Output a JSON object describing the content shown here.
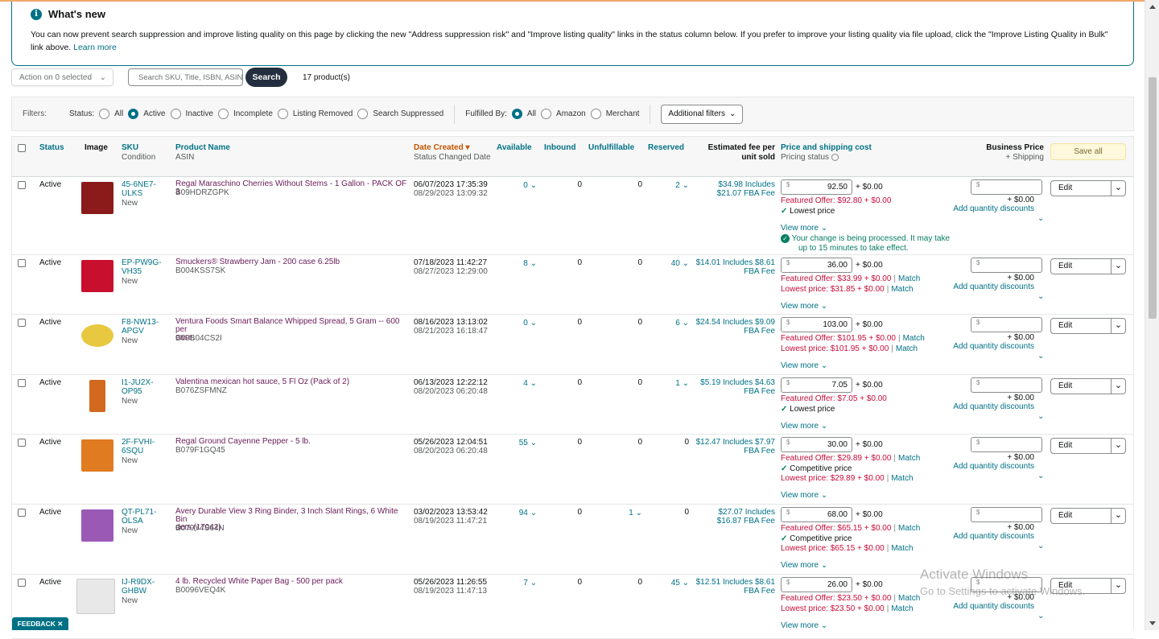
{
  "notice": {
    "title": "What's new",
    "body": "You can now prevent search suppression and improve listing quality on this page by clicking the new \"Address suppression risk\" and \"Improve listing quality\" links in the status column below. If you prefer to improve your listing quality via file upload, click the \"Improve Listing Quality in Bulk\" link above.",
    "learn_more": "Learn more"
  },
  "toolbar": {
    "action_label": "Action on 0 selected",
    "search_placeholder": "Search SKU, Title, ISBN, ASIN",
    "search_button": "Search",
    "product_count": "17 product(s)"
  },
  "filters": {
    "label": "Filters:",
    "status_label": "Status:",
    "status_options": [
      "All",
      "Active",
      "Inactive",
      "Incomplete",
      "Listing Removed",
      "Search Suppressed"
    ],
    "status_selected": "Active",
    "fulfilled_label": "Fulfilled By:",
    "fulfilled_options": [
      "All",
      "Amazon",
      "Merchant"
    ],
    "fulfilled_selected": "All",
    "additional": "Additional filters"
  },
  "columns": {
    "status": "Status",
    "image": "Image",
    "sku": "SKU",
    "condition": "Condition",
    "product_name": "Product Name",
    "asin": "ASIN",
    "date_created": "Date Created",
    "status_changed": "Status Changed Date",
    "available": "Available",
    "inbound": "Inbound",
    "unfulfillable": "Unfulfillable",
    "reserved": "Reserved",
    "fee_line1": "Estimated fee per",
    "fee_line2": "unit sold",
    "price": "Price and shipping cost",
    "pricing_status": "Pricing status",
    "business_price": "Business Price",
    "business_shipping": "+ Shipping",
    "save_all": "Save all"
  },
  "rows": [
    {
      "status": "Active",
      "sku1": "45-6NE7-",
      "sku2": "ULKS",
      "condition": "New",
      "name": "Regal Maraschino Cherries Without Stems - 1 Gallon - PACK OF 3",
      "asin": "B09HDRZGPK",
      "created": "06/07/2023 17:35:39",
      "changed": "08/29/2023 13:09:32",
      "available": "0",
      "inbound": "0",
      "unfulfillable": "0",
      "reserved": "2",
      "fee1": "$34.98 Includes",
      "fee2": "$21.07 FBA Fee",
      "price": "92.50",
      "ship": "+ $0.00",
      "featured": "Featured Offer: $92.80 + $0.00",
      "badge": "Lowest price",
      "lowest": "",
      "processing1": "Your change is being processed. It may take",
      "processing2": "up to 15 minutes to take effect.",
      "view_more": "View more",
      "bship": "+ $0.00",
      "qty": "Add quantity discounts",
      "edit": "Edit",
      "img": "#8B1A1A"
    },
    {
      "status": "Active",
      "sku1": "EP-PW9G-",
      "sku2": "VH35",
      "condition": "New",
      "name": "Smuckers® Strawberry Jam - 200 case 6.25lb",
      "asin": "B004KSS7SK",
      "created": "07/18/2023 11:42:27",
      "changed": "08/27/2023 12:29:00",
      "available": "8",
      "inbound": "0",
      "unfulfillable": "0",
      "reserved": "40",
      "fee1": "$14.01 Includes $8.61",
      "fee2": "FBA Fee",
      "price": "36.00",
      "ship": "+ $0.00",
      "featured": "Featured Offer: $33.99 + $0.00",
      "badge": "",
      "lowest": "Lowest price: $31.85 + $0.00",
      "match": "Match",
      "view_more": "View more",
      "bship": "+ $0.00",
      "qty": "Add quantity discounts",
      "edit": "Edit",
      "img": "#C8102E"
    },
    {
      "status": "Active",
      "sku1": "F8-NW13-",
      "sku2": "APGV",
      "condition": "New",
      "name": "Ventura Foods Smart Balance Whipped Spread, 5 Gram -- 600 per",
      "name2": "case.",
      "asin": "B00B04CS2I",
      "created": "08/16/2023 13:13:02",
      "changed": "08/21/2023 16:18:47",
      "available": "0",
      "inbound": "0",
      "unfulfillable": "0",
      "reserved": "6",
      "fee1": "$24.54 Includes $9.09",
      "fee2": "FBA Fee",
      "price": "103.00",
      "ship": "+ $0.00",
      "featured": "Featured Offer: $101.95 + $0.00",
      "badge": "",
      "lowest": "Lowest price: $101.95 + $0.00",
      "match": "Match",
      "view_more": "View more",
      "bship": "+ $0.00",
      "qty": "Add quantity discounts",
      "edit": "Edit",
      "img": "#E8C840"
    },
    {
      "status": "Active",
      "sku1": "I1-JU2X-",
      "sku2": "OP95",
      "condition": "New",
      "name": "Valentina mexican hot sauce, 5 Fl Oz (Pack of 2)",
      "asin": "B076ZSFMNZ",
      "created": "06/13/2023 12:22:12",
      "changed": "08/20/2023 06:20:48",
      "available": "4",
      "inbound": "0",
      "unfulfillable": "0",
      "reserved": "1",
      "fee1": "$5.19 Includes $4.63",
      "fee2": "FBA Fee",
      "price": "7.05",
      "ship": "+ $0.00",
      "featured": "Featured Offer: $7.05 + $0.00",
      "badge": "Lowest price",
      "lowest": "",
      "view_more": "View more",
      "bship": "+ $0.00",
      "qty": "Add quantity discounts",
      "edit": "Edit",
      "img": "#D2691E"
    },
    {
      "status": "Active",
      "sku1": "2F-FVHI-",
      "sku2": "6SQU",
      "condition": "New",
      "name": "Regal Ground Cayenne Pepper - 5 lb.",
      "asin": "B079F1GQ45",
      "created": "05/26/2023 12:04:51",
      "changed": "08/20/2023 06:20:48",
      "available": "55",
      "inbound": "0",
      "unfulfillable": "0",
      "reserved": "0",
      "fee1": "$12.47 Includes $7.97",
      "fee2": "FBA Fee",
      "price": "30.00",
      "ship": "+ $0.00",
      "featured": "Featured Offer: $29.89 + $0.00",
      "badge": "Competitive price",
      "lowest": "Lowest price: $29.89 + $0.00",
      "match": "Match",
      "view_more": "View more",
      "bship": "+ $0.00",
      "qty": "Add quantity discounts",
      "edit": "Edit",
      "img": "#E07B22"
    },
    {
      "status": "Active",
      "sku1": "QT-PL71-",
      "sku2": "OLSA",
      "condition": "New",
      "name": "Avery Durable View 3 Ring Binder, 3 Inch Slant Rings, 6 White Bin",
      "name2": "ders (17042)",
      "asin": "B079Y4S64N",
      "created": "03/02/2023 13:53:42",
      "changed": "08/19/2023 11:47:21",
      "available": "94",
      "inbound": "0",
      "unfulfillable": "1",
      "reserved": "0",
      "fee1": "$27.07 Includes",
      "fee2": "$16.87 FBA Fee",
      "price": "68.00",
      "ship": "+ $0.00",
      "featured": "Featured Offer: $65.15 + $0.00",
      "badge": "Competitive price",
      "lowest": "Lowest price: $65.15 + $0.00",
      "match": "Match",
      "view_more": "View more",
      "bship": "+ $0.00",
      "qty": "Add quantity discounts",
      "edit": "Edit",
      "img": "#9B59B6"
    },
    {
      "status": "Active",
      "sku1": "IJ-R9DX-",
      "sku2": "GHBW",
      "condition": "New",
      "name": "4 lb. Recycled White Paper Bag - 500 per pack",
      "asin": "B0096VEQ4K",
      "created": "05/26/2023 11:26:55",
      "changed": "08/19/2023 11:47:13",
      "available": "7",
      "inbound": "0",
      "unfulfillable": "0",
      "reserved": "45",
      "fee1": "$12.51 Includes $8.61",
      "fee2": "FBA Fee",
      "price": "26.00",
      "ship": "+ $0.00",
      "featured": "Featured Offer: $23.50 + $0.00",
      "badge": "",
      "lowest": "Lowest price: $23.50 + $0.00",
      "match": "Match",
      "view_more": "View more",
      "bship": "+ $0.00",
      "qty": "Add quantity discounts",
      "edit": "Edit",
      "img": "#E8E8E8"
    }
  ],
  "feedback": "FEEDBACK",
  "watermark": {
    "line1": "Activate Windows",
    "line2": "Go to Settings to activate Windows."
  },
  "colors": {
    "accent": "#007185",
    "product_link": "#6A1B5A",
    "date_sort": "#C45500",
    "success": "#067D62"
  }
}
